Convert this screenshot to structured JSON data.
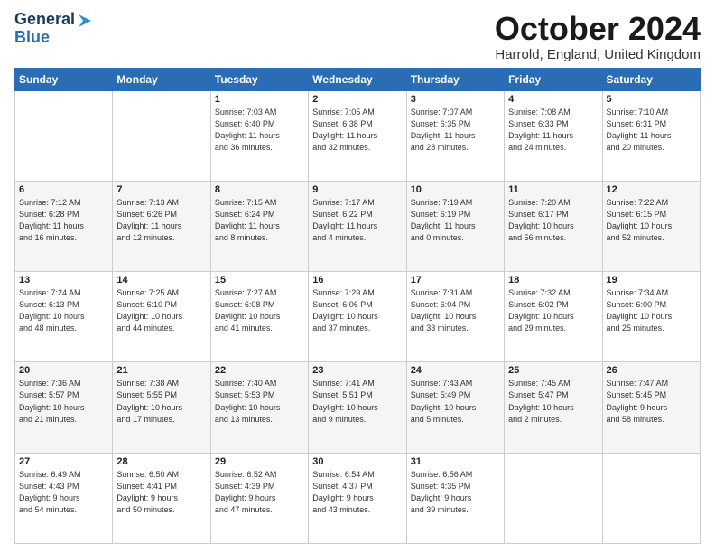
{
  "logo": {
    "line1": "General",
    "line2": "Blue"
  },
  "header": {
    "month": "October 2024",
    "location": "Harrold, England, United Kingdom"
  },
  "weekdays": [
    "Sunday",
    "Monday",
    "Tuesday",
    "Wednesday",
    "Thursday",
    "Friday",
    "Saturday"
  ],
  "weeks": [
    [
      {
        "day": "",
        "text": ""
      },
      {
        "day": "",
        "text": ""
      },
      {
        "day": "1",
        "text": "Sunrise: 7:03 AM\nSunset: 6:40 PM\nDaylight: 11 hours\nand 36 minutes."
      },
      {
        "day": "2",
        "text": "Sunrise: 7:05 AM\nSunset: 6:38 PM\nDaylight: 11 hours\nand 32 minutes."
      },
      {
        "day": "3",
        "text": "Sunrise: 7:07 AM\nSunset: 6:35 PM\nDaylight: 11 hours\nand 28 minutes."
      },
      {
        "day": "4",
        "text": "Sunrise: 7:08 AM\nSunset: 6:33 PM\nDaylight: 11 hours\nand 24 minutes."
      },
      {
        "day": "5",
        "text": "Sunrise: 7:10 AM\nSunset: 6:31 PM\nDaylight: 11 hours\nand 20 minutes."
      }
    ],
    [
      {
        "day": "6",
        "text": "Sunrise: 7:12 AM\nSunset: 6:28 PM\nDaylight: 11 hours\nand 16 minutes."
      },
      {
        "day": "7",
        "text": "Sunrise: 7:13 AM\nSunset: 6:26 PM\nDaylight: 11 hours\nand 12 minutes."
      },
      {
        "day": "8",
        "text": "Sunrise: 7:15 AM\nSunset: 6:24 PM\nDaylight: 11 hours\nand 8 minutes."
      },
      {
        "day": "9",
        "text": "Sunrise: 7:17 AM\nSunset: 6:22 PM\nDaylight: 11 hours\nand 4 minutes."
      },
      {
        "day": "10",
        "text": "Sunrise: 7:19 AM\nSunset: 6:19 PM\nDaylight: 11 hours\nand 0 minutes."
      },
      {
        "day": "11",
        "text": "Sunrise: 7:20 AM\nSunset: 6:17 PM\nDaylight: 10 hours\nand 56 minutes."
      },
      {
        "day": "12",
        "text": "Sunrise: 7:22 AM\nSunset: 6:15 PM\nDaylight: 10 hours\nand 52 minutes."
      }
    ],
    [
      {
        "day": "13",
        "text": "Sunrise: 7:24 AM\nSunset: 6:13 PM\nDaylight: 10 hours\nand 48 minutes."
      },
      {
        "day": "14",
        "text": "Sunrise: 7:25 AM\nSunset: 6:10 PM\nDaylight: 10 hours\nand 44 minutes."
      },
      {
        "day": "15",
        "text": "Sunrise: 7:27 AM\nSunset: 6:08 PM\nDaylight: 10 hours\nand 41 minutes."
      },
      {
        "day": "16",
        "text": "Sunrise: 7:29 AM\nSunset: 6:06 PM\nDaylight: 10 hours\nand 37 minutes."
      },
      {
        "day": "17",
        "text": "Sunrise: 7:31 AM\nSunset: 6:04 PM\nDaylight: 10 hours\nand 33 minutes."
      },
      {
        "day": "18",
        "text": "Sunrise: 7:32 AM\nSunset: 6:02 PM\nDaylight: 10 hours\nand 29 minutes."
      },
      {
        "day": "19",
        "text": "Sunrise: 7:34 AM\nSunset: 6:00 PM\nDaylight: 10 hours\nand 25 minutes."
      }
    ],
    [
      {
        "day": "20",
        "text": "Sunrise: 7:36 AM\nSunset: 5:57 PM\nDaylight: 10 hours\nand 21 minutes."
      },
      {
        "day": "21",
        "text": "Sunrise: 7:38 AM\nSunset: 5:55 PM\nDaylight: 10 hours\nand 17 minutes."
      },
      {
        "day": "22",
        "text": "Sunrise: 7:40 AM\nSunset: 5:53 PM\nDaylight: 10 hours\nand 13 minutes."
      },
      {
        "day": "23",
        "text": "Sunrise: 7:41 AM\nSunset: 5:51 PM\nDaylight: 10 hours\nand 9 minutes."
      },
      {
        "day": "24",
        "text": "Sunrise: 7:43 AM\nSunset: 5:49 PM\nDaylight: 10 hours\nand 5 minutes."
      },
      {
        "day": "25",
        "text": "Sunrise: 7:45 AM\nSunset: 5:47 PM\nDaylight: 10 hours\nand 2 minutes."
      },
      {
        "day": "26",
        "text": "Sunrise: 7:47 AM\nSunset: 5:45 PM\nDaylight: 9 hours\nand 58 minutes."
      }
    ],
    [
      {
        "day": "27",
        "text": "Sunrise: 6:49 AM\nSunset: 4:43 PM\nDaylight: 9 hours\nand 54 minutes."
      },
      {
        "day": "28",
        "text": "Sunrise: 6:50 AM\nSunset: 4:41 PM\nDaylight: 9 hours\nand 50 minutes."
      },
      {
        "day": "29",
        "text": "Sunrise: 6:52 AM\nSunset: 4:39 PM\nDaylight: 9 hours\nand 47 minutes."
      },
      {
        "day": "30",
        "text": "Sunrise: 6:54 AM\nSunset: 4:37 PM\nDaylight: 9 hours\nand 43 minutes."
      },
      {
        "day": "31",
        "text": "Sunrise: 6:56 AM\nSunset: 4:35 PM\nDaylight: 9 hours\nand 39 minutes."
      },
      {
        "day": "",
        "text": ""
      },
      {
        "day": "",
        "text": ""
      }
    ]
  ]
}
